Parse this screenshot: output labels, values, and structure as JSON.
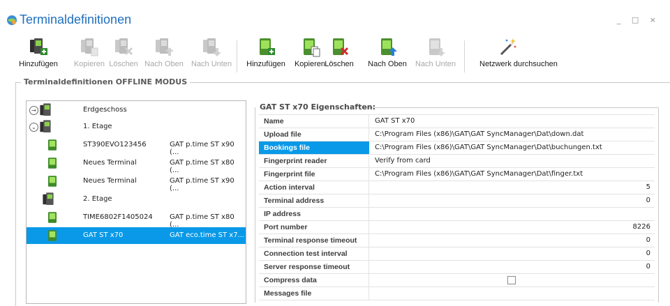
{
  "window": {
    "title": "Terminaldefinitionen",
    "controls": "_ □ ×"
  },
  "toolbar": {
    "group1": [
      {
        "label": "Hinzufügen",
        "enabled": true,
        "icon": "add-group-icon"
      },
      {
        "label": "Kopieren",
        "enabled": false,
        "icon": "copy-group-icon"
      },
      {
        "label": "Löschen",
        "enabled": false,
        "icon": "delete-group-icon"
      },
      {
        "label": "Nach Oben",
        "enabled": false,
        "icon": "move-up-group-icon"
      },
      {
        "label": "Nach Unten",
        "enabled": false,
        "icon": "move-down-group-icon"
      }
    ],
    "group2": [
      {
        "label": "Hinzufügen",
        "enabled": true,
        "icon": "add-terminal-icon"
      },
      {
        "label": "Kopieren",
        "enabled": true,
        "icon": "copy-terminal-icon"
      },
      {
        "label": "Löschen",
        "enabled": true,
        "icon": "delete-terminal-icon"
      },
      {
        "label": "Nach Oben",
        "enabled": true,
        "icon": "move-up-terminal-icon"
      },
      {
        "label": "Nach Unten",
        "enabled": false,
        "icon": "move-down-terminal-icon"
      }
    ],
    "network": {
      "label": "Netzwerk durchsuchen",
      "icon": "magic-wand-icon"
    }
  },
  "group_title": "Terminaldefinitionen OFFLINE MODUS",
  "tree": [
    {
      "name": "Erdgeschoss",
      "type": "",
      "kind": "group",
      "expander": "→"
    },
    {
      "name": "1. Etage",
      "type": "",
      "kind": "group",
      "expander": "⌄"
    },
    {
      "name": "ST390EVO123456",
      "type": "GAT p.time ST x90 (...",
      "kind": "terminal"
    },
    {
      "name": "Neues Terminal",
      "type": "GAT p.time ST x80 (...",
      "kind": "terminal"
    },
    {
      "name": "Neues Terminal",
      "type": "GAT p.time ST x90 (...",
      "kind": "terminal"
    },
    {
      "name": "2. Etage",
      "type": "",
      "kind": "group"
    },
    {
      "name": "TIME6802F1405024",
      "type": "GAT p.time ST x80 (...",
      "kind": "terminal"
    },
    {
      "name": "GAT ST x70",
      "type": "GAT eco.time ST x7...",
      "kind": "terminal",
      "selected": true
    }
  ],
  "properties": {
    "title": "GAT ST x70 Eigenschaften:",
    "rows": [
      {
        "key": "Name",
        "value": "GAT ST x70"
      },
      {
        "key": "Upload file",
        "value": "C:\\Program Files (x86)\\GAT\\GAT SyncManager\\Dat\\down.dat"
      },
      {
        "key": "Bookings file",
        "value": "C:\\Program Files (x86)\\GAT\\GAT SyncManager\\Dat\\buchungen.txt",
        "selected": true
      },
      {
        "key": "Fingerprint reader",
        "value": "Verify from card"
      },
      {
        "key": "Fingerprint file",
        "value": "C:\\Program Files (x86)\\GAT\\GAT SyncManager\\Dat\\finger.txt"
      },
      {
        "key": "Action interval",
        "value": "5",
        "numeric": true
      },
      {
        "key": "Terminal address",
        "value": "0",
        "numeric": true
      },
      {
        "key": "IP address",
        "value": ""
      },
      {
        "key": "Port number",
        "value": "8226",
        "numeric": true
      },
      {
        "key": "Terminal response timeout",
        "value": "0",
        "numeric": true
      },
      {
        "key": "Connection test interval",
        "value": "0",
        "numeric": true
      },
      {
        "key": "Server response timeout",
        "value": "0",
        "numeric": true
      },
      {
        "key": "Compress data",
        "value": "",
        "checkbox": true,
        "checked": false
      },
      {
        "key": "Messages file",
        "value": ""
      }
    ]
  },
  "colors": {
    "accent": "#0a99e8",
    "title": "#1f6fbf",
    "disabled_text": "#a8a8a8"
  }
}
